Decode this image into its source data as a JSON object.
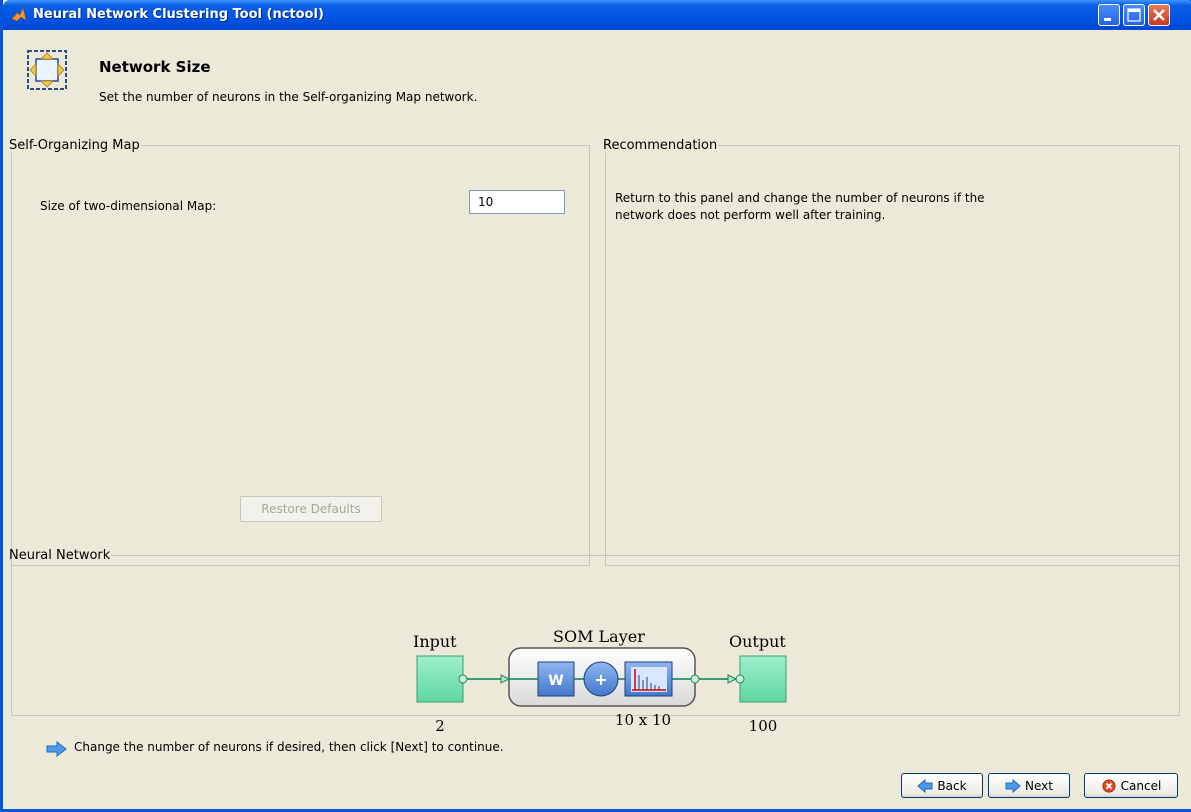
{
  "window": {
    "title": "Neural Network Clustering Tool (nctool)"
  },
  "header": {
    "title": "Network Size",
    "subtitle": "Set the number of neurons in the Self-organizing Map network."
  },
  "som_panel": {
    "legend": "Self-Organizing Map",
    "size_label": "Size of two-dimensional Map:",
    "size_value": "10",
    "restore_button": "Restore Defaults"
  },
  "recommendation": {
    "legend": "Recommendation",
    "text": "Return to this panel and change the number of neurons if the network does not perform well after training."
  },
  "network": {
    "legend": "Neural Network",
    "input_label": "Input",
    "input_size": "2",
    "layer_label": "SOM Layer",
    "weight_label": "W",
    "sum_label": "+",
    "layer_size": "10 x 10",
    "output_label": "Output",
    "output_size": "100"
  },
  "footer": {
    "hint": "Change the number of neurons if desired, then click [Next] to continue.",
    "back": "Back",
    "next": "Next",
    "cancel": "Cancel"
  },
  "colors": {
    "titlebar": "#0054e3",
    "node_fill": "#80e6b9",
    "weight_fill": "#5b8fd6"
  }
}
